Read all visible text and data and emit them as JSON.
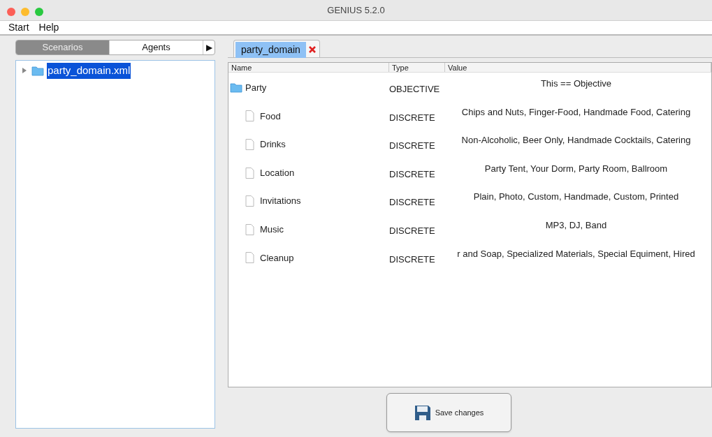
{
  "window": {
    "title": "GENIUS 5.2.0"
  },
  "menu": [
    "Start",
    "Help"
  ],
  "left_tabs": [
    {
      "label": "Scenarios",
      "selected": true
    },
    {
      "label": "Agents",
      "selected": false
    }
  ],
  "left_tabs_more": "▶",
  "tree": [
    {
      "label": "party_domain.xml",
      "selected": true,
      "expanded": false
    }
  ],
  "editor_tabs": [
    {
      "label": "party_domain",
      "selected": true
    }
  ],
  "table": {
    "columns": [
      "Name",
      "Type",
      "Value"
    ],
    "rows": [
      {
        "name": "Party",
        "type": "OBJECTIVE",
        "value": "This == Objective",
        "children": [
          {
            "name": "Food",
            "type": "DISCRETE",
            "value": "Chips and Nuts, Finger-Food, Handmade Food, Catering"
          },
          {
            "name": "Drinks",
            "type": "DISCRETE",
            "value": "Non-Alcoholic, Beer Only, Handmade Cocktails, Catering"
          },
          {
            "name": "Location",
            "type": "DISCRETE",
            "value": "Party Tent, Your Dorm, Party Room, Ballroom"
          },
          {
            "name": "Invitations",
            "type": "DISCRETE",
            "value": "Plain, Photo, Custom, Handmade, Custom, Printed"
          },
          {
            "name": "Music",
            "type": "DISCRETE",
            "value": "MP3, DJ, Band"
          },
          {
            "name": "Cleanup",
            "type": "DISCRETE",
            "value": "r and Soap, Specialized Materials, Special Equiment, Hired"
          }
        ]
      }
    ]
  },
  "save_button": "Save changes"
}
